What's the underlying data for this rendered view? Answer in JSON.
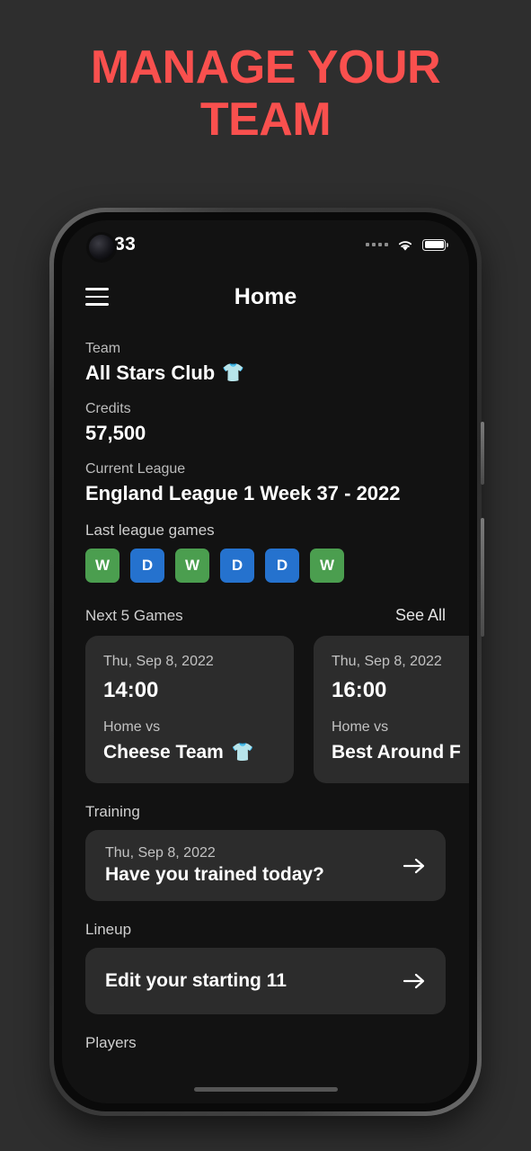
{
  "promo": {
    "headline": "MANAGE YOUR TEAM",
    "accent_color": "#f9504e"
  },
  "phone": {
    "status_bar": {
      "time": "2.33",
      "wifi_icon": "wifi-icon",
      "battery_icon": "battery-full-icon",
      "signal_icon": "signal-dots-icon"
    },
    "app_bar": {
      "menu_icon": "hamburger-menu-icon",
      "title": "Home"
    },
    "team": {
      "label": "Team",
      "name": "All Stars Club",
      "jersey_icon": "jersey-icon",
      "jersey_color": "#1414f0"
    },
    "credits": {
      "label": "Credits",
      "value": "57,500"
    },
    "league": {
      "label": "Current League",
      "value": "England League 1 Week 37 - 2022"
    },
    "last_games": {
      "label": "Last league games",
      "results": [
        {
          "result": "W",
          "color": "#4b9e4f"
        },
        {
          "result": "D",
          "color": "#2572ce"
        },
        {
          "result": "W",
          "color": "#4b9e4f"
        },
        {
          "result": "D",
          "color": "#2572ce"
        },
        {
          "result": "D",
          "color": "#2572ce"
        },
        {
          "result": "W",
          "color": "#4b9e4f"
        }
      ]
    },
    "next_games": {
      "title": "Next 5 Games",
      "see_all": "See All",
      "cards": [
        {
          "date": "Thu, Sep 8, 2022",
          "time": "14:00",
          "venue": "Home vs",
          "opponent": "Cheese Team",
          "jersey_icon": "jersey-icon",
          "jersey_color": "#18e021"
        },
        {
          "date": "Thu, Sep 8, 2022",
          "time": "16:00",
          "venue": "Home vs",
          "opponent": "Best Around F",
          "jersey_icon": "jersey-icon",
          "jersey_color": "#18e021"
        }
      ]
    },
    "training": {
      "label": "Training",
      "date": "Thu, Sep 8, 2022",
      "prompt": "Have you trained today?",
      "arrow_icon": "arrow-right-icon"
    },
    "lineup": {
      "label": "Lineup",
      "action": "Edit your starting 11",
      "arrow_icon": "arrow-right-icon"
    },
    "players": {
      "label": "Players"
    }
  }
}
